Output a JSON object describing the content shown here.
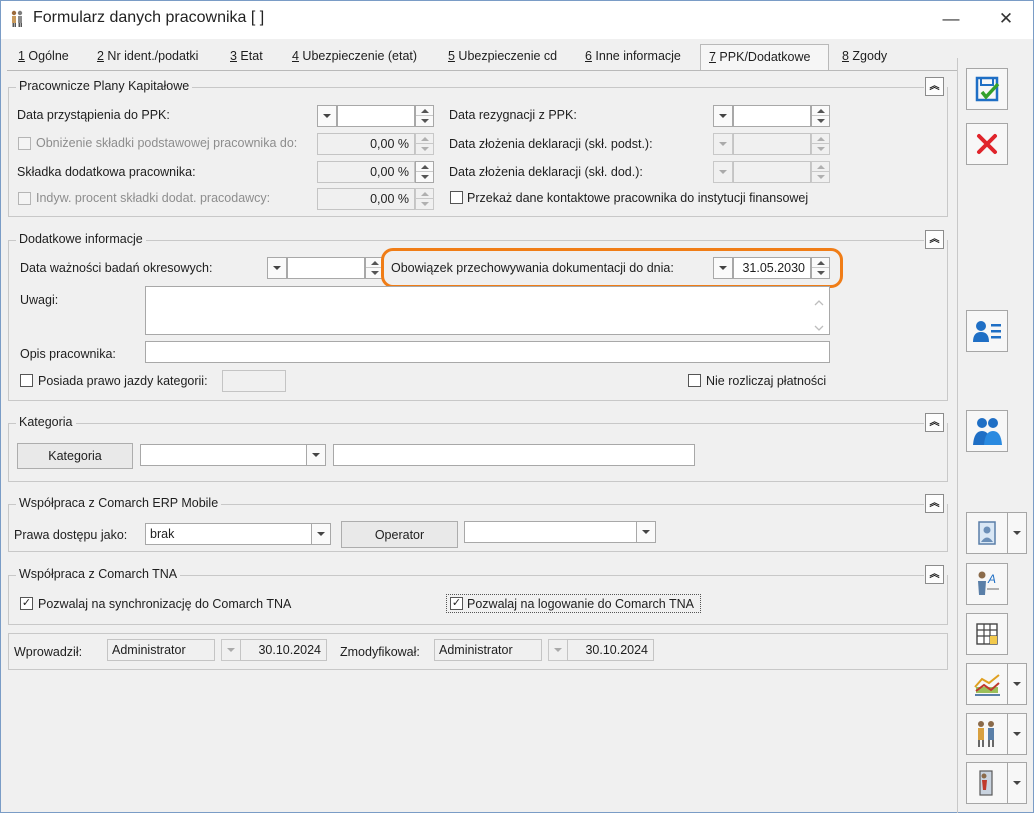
{
  "window": {
    "title": "Formularz danych pracownika [ ]",
    "minimize": "—",
    "close": "✕"
  },
  "tabs": [
    {
      "key": "1",
      "label": " Ogólne"
    },
    {
      "key": "2",
      "label": " Nr ident./podatki"
    },
    {
      "key": "3",
      "label": " Etat"
    },
    {
      "key": "4",
      "label": " Ubezpieczenie (etat)"
    },
    {
      "key": "5",
      "label": " Ubezpieczenie cd"
    },
    {
      "key": "6",
      "label": " Inne informacje"
    },
    {
      "key": "7",
      "label": " PPK/Dodatkowe"
    },
    {
      "key": "8",
      "label": " Zgody"
    }
  ],
  "collapse_glyph": "︽",
  "ppk": {
    "title": "Pracownicze Plany Kapitałowe",
    "join_date_label": "Data przystąpienia do PPK:",
    "join_date_value": "",
    "reduce_label": "Obniżenie składki podstawowej pracownika do:",
    "reduce_value": "0,00 %",
    "extra_label": "Składka dodatkowa pracownika:",
    "extra_value": "0,00 %",
    "indiv_label": "Indyw. procent składki dodat. pracodawcy:",
    "indiv_value": "0,00 %",
    "resign_label": "Data rezygnacji z PPK:",
    "resign_value": "",
    "decl_basic_label": "Data złożenia deklaracji (skł. podst.):",
    "decl_extra_label": "Data złożenia deklaracji (skł. dod.):",
    "contact_label": "Przekaż dane kontaktowe pracownika do instytucji finansowej"
  },
  "additional": {
    "title": "Dodatkowe informacje",
    "medical_label": "Data ważności badań okresowych:",
    "medical_value": "",
    "retention_label": "Obowiązek przechowywania dokumentacji do dnia:",
    "retention_value": "31.05.2030",
    "notes_label": "Uwagi:",
    "notes_value": "",
    "desc_label": "Opis pracownika:",
    "desc_value": "",
    "license_label": "Posiada prawo jazdy kategorii:",
    "license_value": "",
    "no_payments_label": "Nie rozliczaj płatności"
  },
  "category": {
    "title": "Kategoria",
    "button": "Kategoria",
    "select_value": "",
    "desc_value": ""
  },
  "mobile": {
    "title": "Współpraca z Comarch ERP Mobile",
    "access_label": "Prawa dostępu jako:",
    "access_value": "brak",
    "operator_button": "Operator",
    "operator_value": ""
  },
  "tna": {
    "title": "Współpraca z Comarch TNA",
    "sync_label": "Pozwalaj na synchronizację do Comarch TNA",
    "sync_checked": true,
    "login_label": "Pozwalaj na logowanie do Comarch TNA",
    "login_checked": true,
    "check_glyph": "✓"
  },
  "footer": {
    "entered_label": "Wprowadził:",
    "entered_by": "Administrator",
    "entered_date": "30.10.2024",
    "modified_label": "Zmodyfikował:",
    "modified_by": "Administrator",
    "modified_date": "30.10.2024"
  },
  "toolbar_icons": [
    "save-icon",
    "cancel-icon",
    "employee-card-icon",
    "people-icon",
    "photo-icon",
    "attribute-icon",
    "table-icon",
    "chart-icon",
    "family-icon",
    "exit-icon"
  ],
  "colors": {
    "highlight": "#f07d17",
    "accent_blue": "#1f6fc5",
    "cancel_red": "#e0242b"
  }
}
